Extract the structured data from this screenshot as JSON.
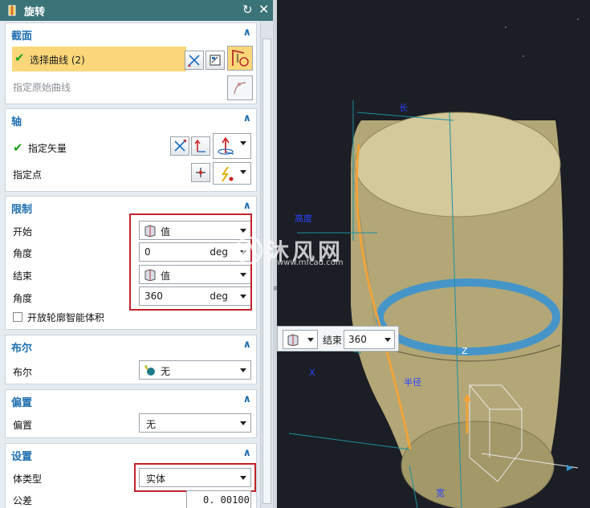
{
  "dialog": {
    "title": "旋转",
    "reset_icon": "reset-icon",
    "close_icon": "close-icon"
  },
  "section_cross": {
    "title": "截面",
    "select_curve_label": "选择曲线 (2)",
    "original_curve_label": "指定原始曲线"
  },
  "section_axis": {
    "title": "轴",
    "vector_label": "指定矢量",
    "point_label": "指定点"
  },
  "section_limits": {
    "title": "限制",
    "start_label": "开始",
    "start_value": "值",
    "start_angle_label": "角度",
    "start_angle": "0",
    "start_unit": "deg",
    "end_label": "结束",
    "end_value": "值",
    "end_angle_label": "角度",
    "end_angle": "360",
    "end_unit": "deg",
    "open_profile_label": "开放轮廓智能体积"
  },
  "section_boolean": {
    "title": "布尔",
    "boolean_label": "布尔",
    "boolean_value": "无"
  },
  "section_offset": {
    "title": "偏置",
    "offset_label": "偏置",
    "offset_value": "无"
  },
  "section_settings": {
    "title": "设置",
    "body_type_label": "体类型",
    "body_type_value": "实体",
    "tolerance_label": "公差",
    "tolerance_value": "0. 00100"
  },
  "viewport": {
    "popup_end_label": "结束",
    "popup_end_value": "360",
    "axis_z_label": "Z",
    "watermark_text": "沐风网",
    "watermark_url": "www.mfcad.com",
    "dim_labels": [
      "长",
      "高度",
      "X",
      "半径",
      "宽"
    ]
  },
  "colors": {
    "title_bar": "#3a7378",
    "section_title": "#1f6fb0",
    "highlight": "#fbd77a",
    "check": "#1ea11e",
    "red_box": "#c0232a",
    "model_fill": "#b3a777",
    "ring": "#3a93d0",
    "curve": "#f0a33a",
    "viewport_bg": "#1b1e24"
  }
}
